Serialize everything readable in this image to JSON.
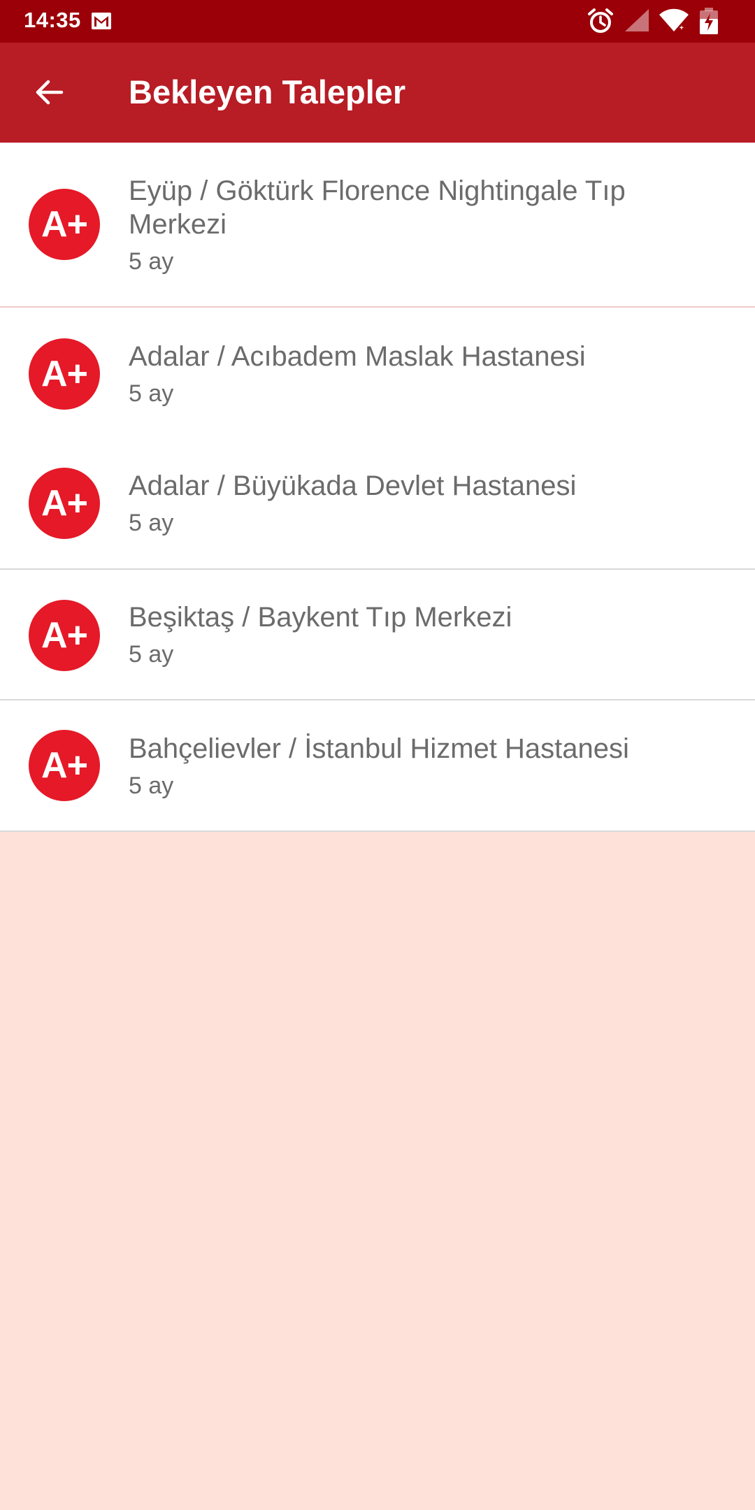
{
  "status_bar": {
    "time": "14:35",
    "icons": [
      "gmail-icon",
      "alarm-icon",
      "signal-icon",
      "wifi-icon",
      "battery-charging-icon"
    ]
  },
  "app_bar": {
    "title": "Bekleyen Talepler",
    "back_icon": "arrow-left-icon"
  },
  "colors": {
    "status_bar": "#9b0008",
    "app_bar": "#b81c24",
    "badge": "#e51927",
    "background": "#fee2d9"
  },
  "requests": [
    {
      "blood_type": "A+",
      "title": "Eyüp / Göktürk Florence Nightingale Tıp Merkezi",
      "time": "5 ay"
    },
    {
      "blood_type": "A+",
      "title": "Adalar / Acıbadem Maslak Hastanesi",
      "time": "5 ay"
    },
    {
      "blood_type": "A+",
      "title": "Adalar / Büyükada Devlet Hastanesi",
      "time": "5 ay"
    },
    {
      "blood_type": "A+",
      "title": "Beşiktaş / Baykent Tıp Merkezi",
      "time": "5 ay"
    },
    {
      "blood_type": "A+",
      "title": "Bahçelievler / İstanbul Hizmet Hastanesi",
      "time": "5 ay"
    }
  ]
}
